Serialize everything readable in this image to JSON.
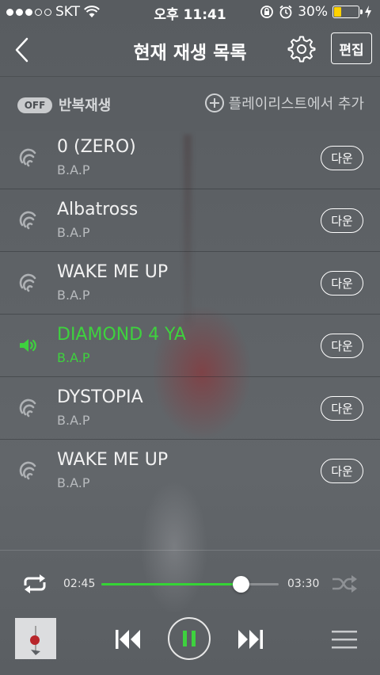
{
  "status_bar": {
    "carrier": "SKT",
    "time": "오후 11:41",
    "battery": "30%",
    "battery_level": 0.3
  },
  "header": {
    "title": "현재 재생 목록",
    "edit_label": "편집"
  },
  "options": {
    "repeat_toggle": "OFF",
    "repeat_label": "반복재생",
    "add_playlist_label": "플레이리스트에서 추가"
  },
  "songs": [
    {
      "title": "0 (ZERO)",
      "artist": "B.A.P",
      "download_label": "다운",
      "playing": false
    },
    {
      "title": "Albatross",
      "artist": "B.A.P",
      "download_label": "다운",
      "playing": false
    },
    {
      "title": "WAKE ME UP",
      "artist": "B.A.P",
      "download_label": "다운",
      "playing": false
    },
    {
      "title": "DIAMOND 4 YA",
      "artist": "B.A.P",
      "download_label": "다운",
      "playing": true
    },
    {
      "title": "DYSTOPIA",
      "artist": "B.A.P",
      "download_label": "다운",
      "playing": false
    },
    {
      "title": "WAKE ME UP",
      "artist": "B.A.P",
      "download_label": "다운",
      "playing": false
    }
  ],
  "player": {
    "elapsed": "02:45",
    "duration": "03:30",
    "progress": 0.7857,
    "state": "playing"
  },
  "colors": {
    "accent": "#3ed23e",
    "battery": "#ffd200"
  },
  "icons": [
    "back-icon",
    "gear-icon",
    "plus-circle-icon",
    "sound-wave-icon",
    "speaker-icon",
    "repeat-icon",
    "shuffle-icon",
    "previous-icon",
    "pause-icon",
    "next-icon",
    "menu-icon"
  ]
}
